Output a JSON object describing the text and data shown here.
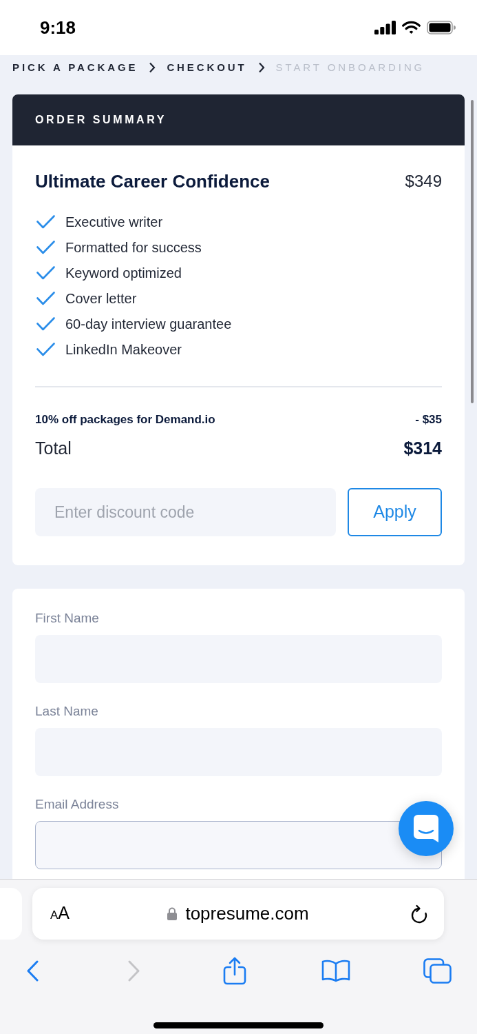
{
  "status_bar": {
    "time": "9:18"
  },
  "breadcrumb": [
    {
      "label": "PICK A PACKAGE",
      "reached": true
    },
    {
      "label": "CHECKOUT",
      "reached": true
    },
    {
      "label": "START ONBOARDING",
      "reached": false
    }
  ],
  "order_summary": {
    "header": "ORDER SUMMARY",
    "package": {
      "name": "Ultimate Career Confidence",
      "price": "$349"
    },
    "features": [
      "Executive writer",
      "Formatted for success",
      "Keyword optimized",
      "Cover letter",
      "60-day interview guarantee",
      "LinkedIn Makeover"
    ],
    "discount": {
      "label": "10% off packages for Demand.io",
      "amount": "- $35"
    },
    "total": {
      "label": "Total",
      "amount": "$314"
    },
    "discount_code": {
      "placeholder": "Enter discount code"
    },
    "apply_button": "Apply"
  },
  "form": {
    "fields": [
      {
        "label": "First Name",
        "focused": false
      },
      {
        "label": "Last Name",
        "focused": false
      },
      {
        "label": "Email Address",
        "focused": true
      }
    ]
  },
  "browser": {
    "text_size_button": "AA",
    "url": "topresume.com",
    "back_disabled": false,
    "forward_disabled": true
  }
}
